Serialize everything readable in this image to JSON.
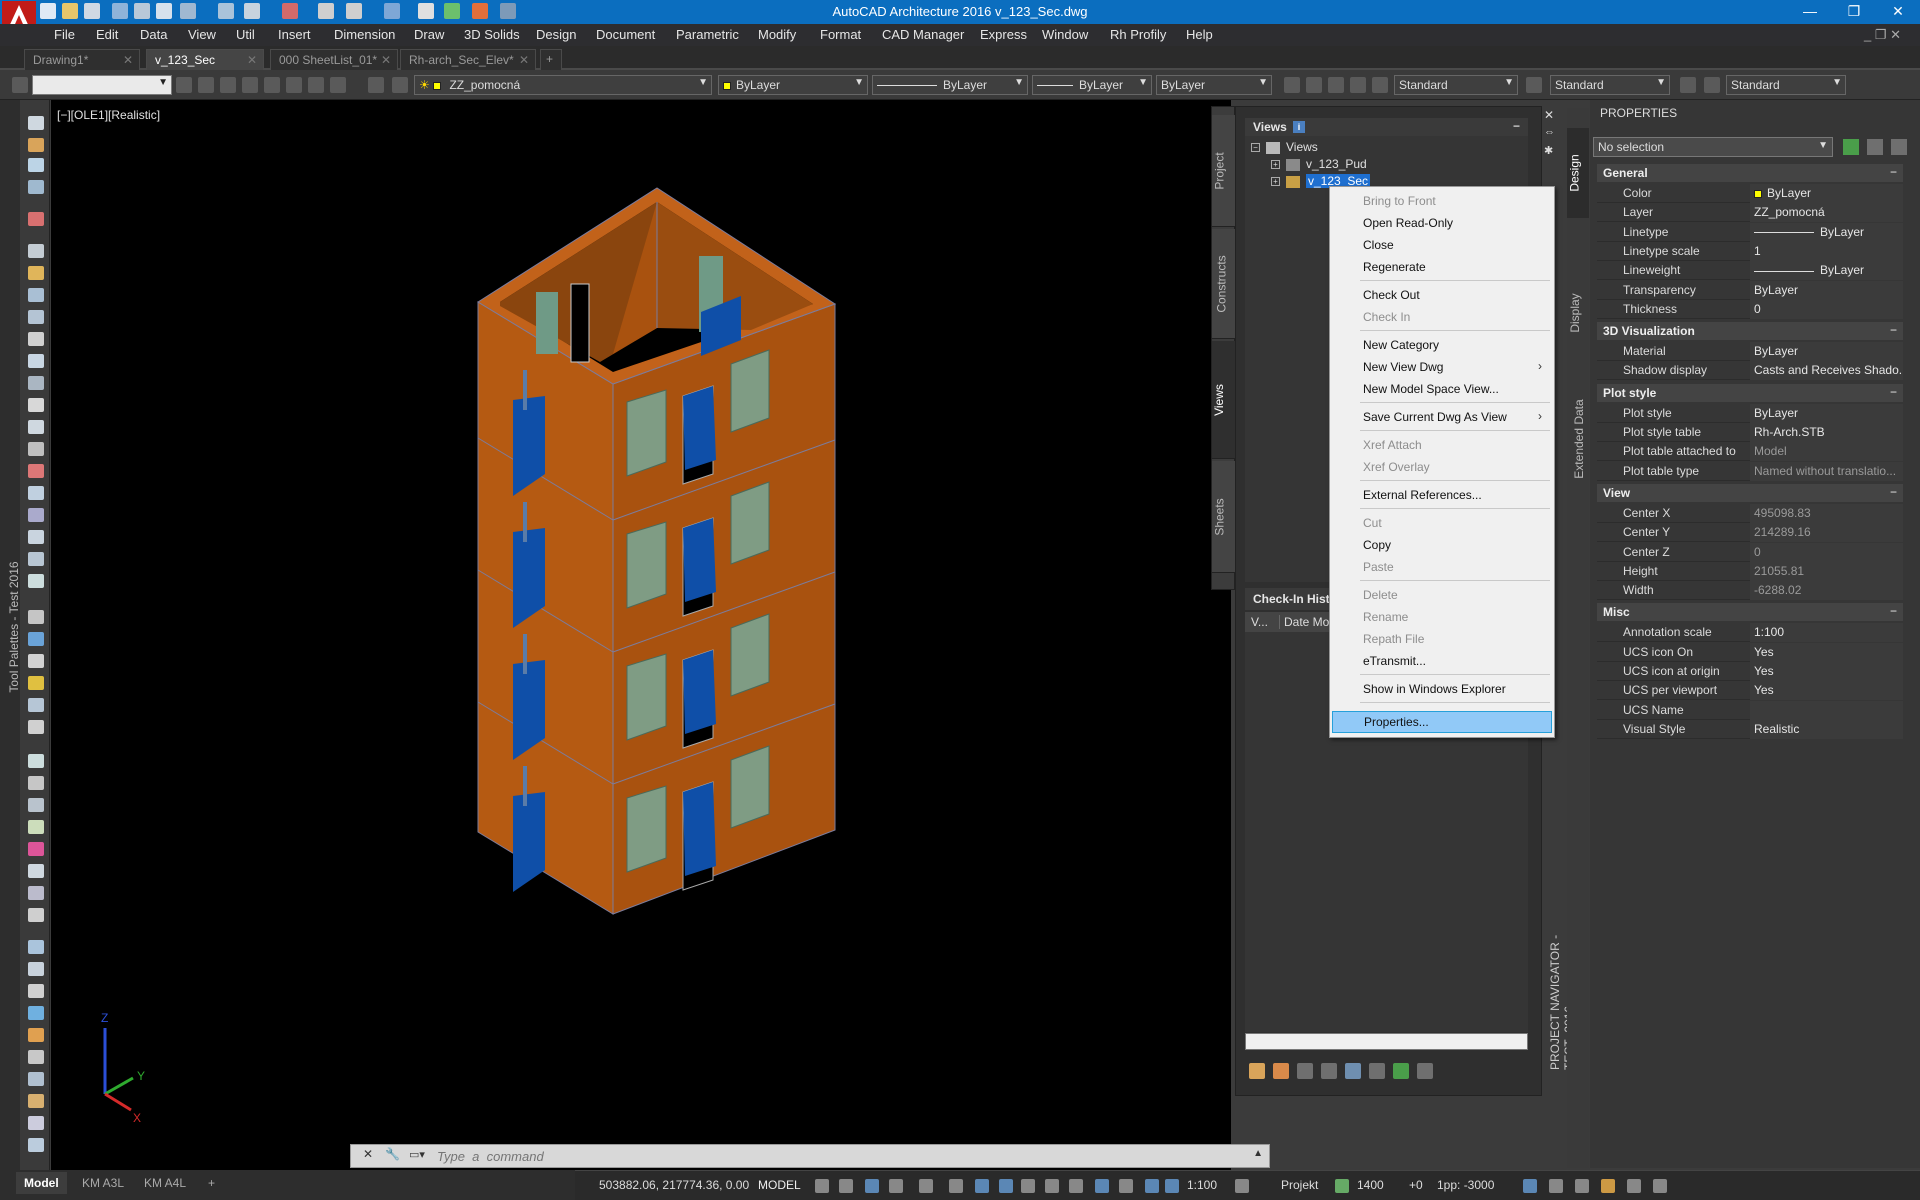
{
  "window": {
    "title": "AutoCAD Architecture 2016    v_123_Sec.dwg"
  },
  "menu": [
    "File",
    "Edit",
    "Data",
    "View",
    "Util",
    "Insert",
    "Dimension",
    "Draw",
    "3D Solids",
    "Design",
    "Document",
    "Parametric",
    "Modify",
    "Format",
    "CAD Manager",
    "Express",
    "Window",
    "Rh Profily",
    "Help"
  ],
  "tabs": [
    {
      "label": "Drawing1*"
    },
    {
      "label": "v_123_Sec",
      "active": true
    },
    {
      "label": "000 SheetList_01*"
    },
    {
      "label": "Rh-arch_Sec_Elev*"
    }
  ],
  "toolbar": {
    "layer": "ZZ_pomocná",
    "color": "ByLayer",
    "linetype": "ByLayer",
    "lineweight": "ByLayer",
    "plotstyle": "ByLayer",
    "textstyle": "Standard",
    "dimstyle": "Standard",
    "tablestyle": "Standard"
  },
  "palette_label": "Tool Palettes - Test 2016",
  "viewport": {
    "label": "[−][OLE1][Realistic]",
    "axis_z": "Z",
    "axis_y": "Y",
    "axis_x": "X"
  },
  "command": {
    "placeholder": "Type  a  command"
  },
  "layout_tabs": [
    {
      "label": "Model",
      "active": true
    },
    {
      "label": "KM A3L"
    },
    {
      "label": "KM A4L"
    }
  ],
  "status": {
    "coords": "503882.06, 217774.36, 0.00",
    "model": "MODEL",
    "scale": "1:100",
    "workspace": "Projekt",
    "level": "1400",
    "elevation": "+0",
    "cut": "1pp: -3000"
  },
  "navigator": {
    "side_tabs": [
      "Project",
      "Constructs",
      "Views",
      "Sheets"
    ],
    "active_tab": "Views",
    "views_title": "Views",
    "tree": [
      {
        "label": "Views",
        "level": 0
      },
      {
        "label": "v_123_Pud",
        "level": 1
      },
      {
        "label": "v_123_Sec",
        "level": 1,
        "selected": true
      }
    ],
    "checkin_title": "Check-In Hist",
    "checkin_cols": [
      "V...",
      "Date Mo"
    ],
    "vertical_title": "PROJECT NAVIGATOR - TEST_2016"
  },
  "context_menu": {
    "groups": [
      [
        {
          "label": "Bring to Front",
          "disabled": true
        },
        {
          "label": "Open Read-Only"
        },
        {
          "label": "Close"
        },
        {
          "label": "Regenerate"
        }
      ],
      [
        {
          "label": "Check Out"
        },
        {
          "label": "Check In",
          "disabled": true
        }
      ],
      [
        {
          "label": "New Category"
        },
        {
          "label": "New View Dwg",
          "submenu": true
        },
        {
          "label": "New Model Space View..."
        }
      ],
      [
        {
          "label": "Save Current Dwg As View",
          "submenu": true
        }
      ],
      [
        {
          "label": "Xref Attach",
          "disabled": true
        },
        {
          "label": "Xref Overlay",
          "disabled": true
        }
      ],
      [
        {
          "label": "External References..."
        }
      ],
      [
        {
          "label": "Cut",
          "disabled": true
        },
        {
          "label": "Copy"
        },
        {
          "label": "Paste",
          "disabled": true
        }
      ],
      [
        {
          "label": "Delete",
          "disabled": true
        },
        {
          "label": "Rename",
          "disabled": true
        },
        {
          "label": "Repath File",
          "disabled": true
        },
        {
          "label": "eTransmit..."
        }
      ],
      [
        {
          "label": "Show in Windows Explorer"
        }
      ],
      [
        {
          "label": "Properties...",
          "highlight": true
        }
      ]
    ]
  },
  "properties": {
    "title": "PROPERTIES",
    "selection": "No selection",
    "side_tabs": [
      "Design",
      "Display",
      "Extended Data"
    ],
    "sections": [
      {
        "name": "General",
        "rows": [
          {
            "k": "Color",
            "v": "ByLayer",
            "swatch": true
          },
          {
            "k": "Layer",
            "v": "ZZ_pomocná"
          },
          {
            "k": "Linetype",
            "v": "ByLayer",
            "line": true
          },
          {
            "k": "Linetype scale",
            "v": "1"
          },
          {
            "k": "Lineweight",
            "v": "ByLayer",
            "line": true
          },
          {
            "k": "Transparency",
            "v": "ByLayer"
          },
          {
            "k": "Thickness",
            "v": "0"
          }
        ]
      },
      {
        "name": "3D Visualization",
        "rows": [
          {
            "k": "Material",
            "v": "ByLayer"
          },
          {
            "k": "Shadow display",
            "v": "Casts and Receives Shado..."
          }
        ]
      },
      {
        "name": "Plot style",
        "rows": [
          {
            "k": "Plot style",
            "v": "ByLayer"
          },
          {
            "k": "Plot style table",
            "v": "Rh-Arch.STB"
          },
          {
            "k": "Plot table attached to",
            "v": "Model",
            "ro": true
          },
          {
            "k": "Plot table type",
            "v": "Named without translatio...",
            "ro": true
          }
        ]
      },
      {
        "name": "View",
        "rows": [
          {
            "k": "Center X",
            "v": "495098.83",
            "ro": true
          },
          {
            "k": "Center Y",
            "v": "214289.16",
            "ro": true
          },
          {
            "k": "Center Z",
            "v": "0",
            "ro": true
          },
          {
            "k": "Height",
            "v": "21055.81",
            "ro": true
          },
          {
            "k": "Width",
            "v": "-6288.02",
            "ro": true
          }
        ]
      },
      {
        "name": "Misc",
        "rows": [
          {
            "k": "Annotation scale",
            "v": "1:100"
          },
          {
            "k": "UCS icon On",
            "v": "Yes"
          },
          {
            "k": "UCS icon at origin",
            "v": "Yes"
          },
          {
            "k": "UCS per viewport",
            "v": "Yes"
          },
          {
            "k": "UCS Name",
            "v": ""
          },
          {
            "k": "Visual Style",
            "v": "Realistic"
          }
        ]
      }
    ]
  },
  "colors": {
    "title_bar": "#0b6ebf",
    "wall": "#b55a12",
    "door": "#0f4fa8",
    "window_glass": "#7f9c84",
    "menu_highlight": "#91c9f7"
  }
}
